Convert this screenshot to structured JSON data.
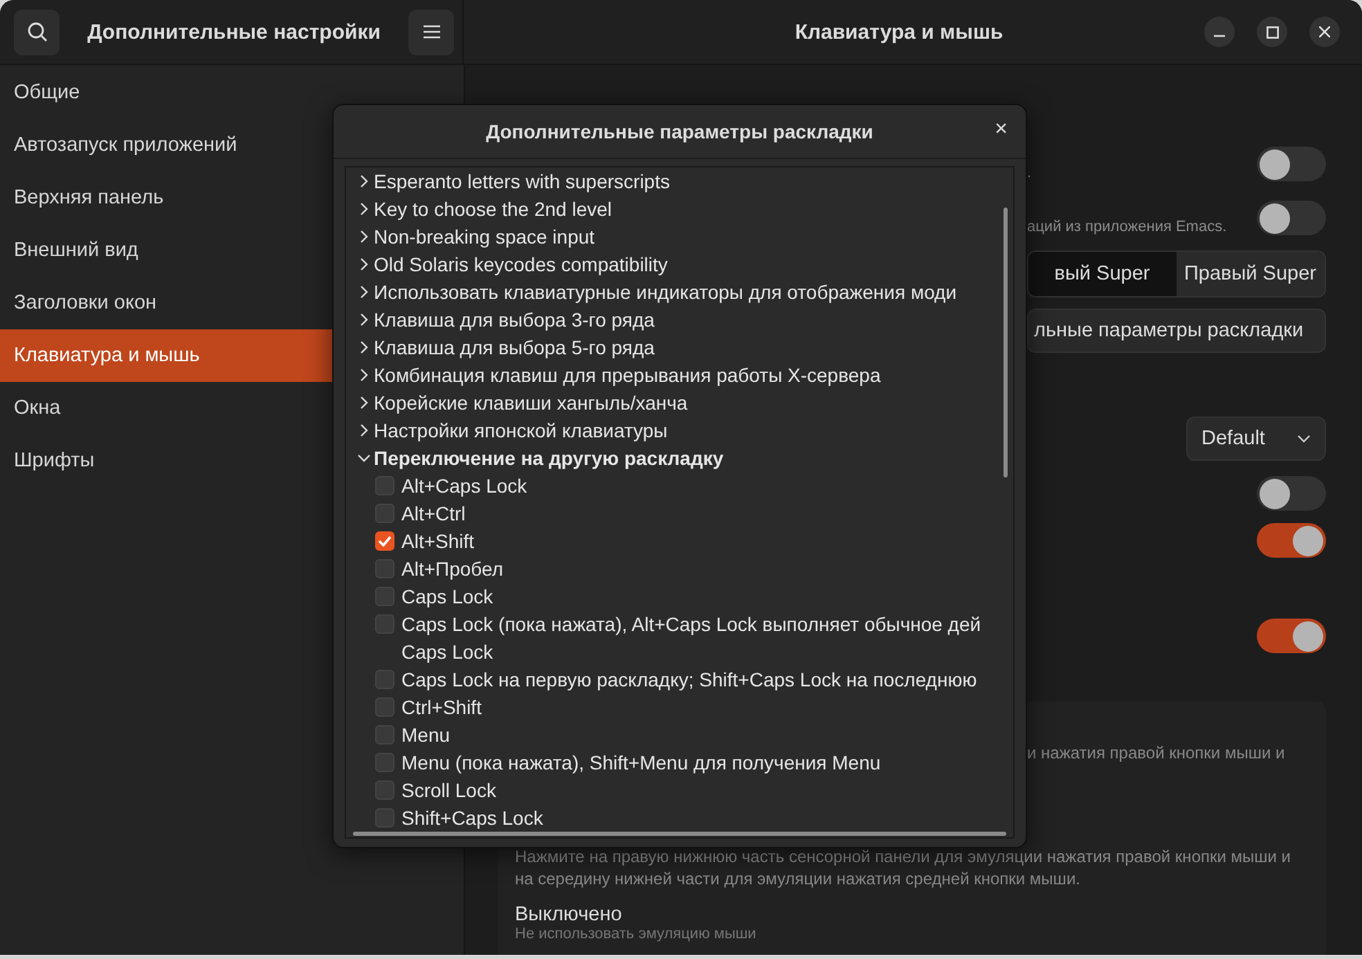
{
  "header": {
    "sidebar_title": "Дополнительные настройки",
    "title": "Клавиатура и мышь"
  },
  "sidebar": {
    "items": [
      {
        "label": "Общие",
        "selected": false
      },
      {
        "label": "Автозапуск приложений",
        "selected": false
      },
      {
        "label": "Верхняя панель",
        "selected": false
      },
      {
        "label": "Внешний вид",
        "selected": false
      },
      {
        "label": "Заголовки окон",
        "selected": false
      },
      {
        "label": "Клавиатура и мышь",
        "selected": true
      },
      {
        "label": "Окна",
        "selected": false
      },
      {
        "label": "Шрифты",
        "selected": false
      }
    ]
  },
  "panel": {
    "rows": [
      {
        "kind": "toggle",
        "text": ".",
        "on": false
      },
      {
        "kind": "toggle",
        "text": "аций из приложения Emacs.",
        "on": false
      },
      {
        "kind": "segmented",
        "options": [
          {
            "label": "вый Super",
            "selected": true
          },
          {
            "label": "Правый Super",
            "selected": false
          }
        ]
      },
      {
        "kind": "button",
        "label": "льные параметры раскладки"
      },
      {
        "kind": "dropdown",
        "value": "Default"
      },
      {
        "kind": "toggle",
        "on": false
      },
      {
        "kind": "toggle",
        "on": true
      },
      {
        "kind": "toggle",
        "on": true
      }
    ],
    "card": {
      "partial_text": "и нажатия правой кнопки мыши и",
      "description": "Нажмите на правую нижнюю часть сенсорной панели для эмуляции нажатия правой кнопки мыши и на середину нижней части для эмуляции нажатия средней кнопки мыши.",
      "option_title": "Выключено",
      "option_subtitle": "Не использовать эмуляцию мыши"
    }
  },
  "dialog": {
    "title": "Дополнительные параметры раскладки",
    "close": "×",
    "tree": [
      {
        "label": "Esperanto letters with superscripts",
        "expanded": false
      },
      {
        "label": "Key to choose the 2nd level",
        "expanded": false
      },
      {
        "label": "Non-breaking space input",
        "expanded": false
      },
      {
        "label": "Old Solaris keycodes compatibility",
        "expanded": false
      },
      {
        "label": "Использовать клавиатурные индикаторы для отображения моди",
        "expanded": false
      },
      {
        "label": "Клавиша для выбора 3-го ряда",
        "expanded": false
      },
      {
        "label": "Клавиша для выбора 5-го ряда",
        "expanded": false
      },
      {
        "label": "Комбинация клавиш для прерывания работы X-сервера",
        "expanded": false
      },
      {
        "label": "Корейские клавиши хангыль/ханча",
        "expanded": false
      },
      {
        "label": "Настройки японской клавиатуры",
        "expanded": false
      },
      {
        "label": "Переключение на другую раскладку",
        "expanded": true,
        "children": [
          {
            "label": "Alt+Caps Lock",
            "checked": false
          },
          {
            "label": "Alt+Ctrl",
            "checked": false
          },
          {
            "label": "Alt+Shift",
            "checked": true
          },
          {
            "label": "Alt+Пробел",
            "checked": false
          },
          {
            "label": "Caps Lock",
            "checked": false
          },
          {
            "label": "Caps Lock (пока нажата), Alt+Caps Lock выполняет обычное дей",
            "label_line_2": "Caps Lock",
            "checked": false
          },
          {
            "label": "Caps Lock на первую раскладку; Shift+Caps Lock на последнюю",
            "checked": false
          },
          {
            "label": "Ctrl+Shift",
            "checked": false
          },
          {
            "label": "Menu",
            "checked": false
          },
          {
            "label": "Menu (пока нажата), Shift+Menu для получения Menu",
            "checked": false
          },
          {
            "label": "Scroll Lock",
            "checked": false
          },
          {
            "label": "Shift+Caps Lock",
            "checked": false
          }
        ]
      }
    ]
  }
}
